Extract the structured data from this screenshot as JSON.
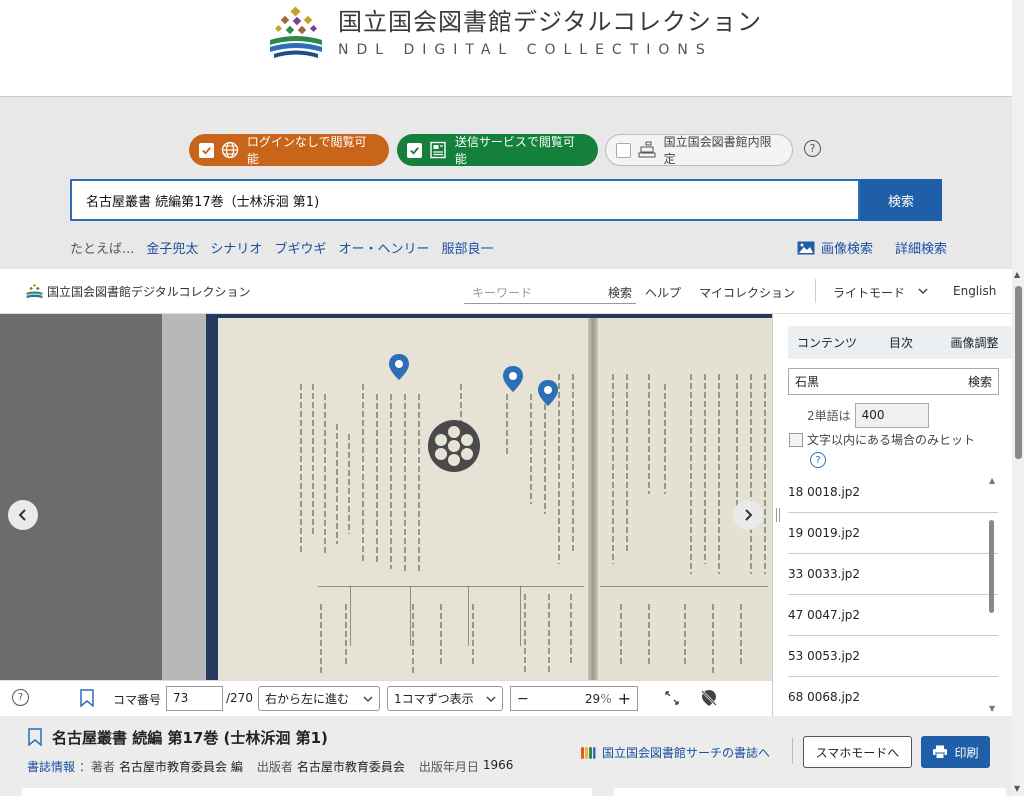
{
  "header": {
    "title_jp": "国立国会図書館デジタルコレクション",
    "title_en": "NDL DIGITAL COLLECTIONS",
    "logo_icon": "ndl-logo-icon"
  },
  "filters": {
    "login_free": "ログインなしで閲覧可能",
    "transmission": "送信サービスで閲覧可能",
    "inside_library": "国立国会図書館内限定",
    "help": "?"
  },
  "search": {
    "query": "名古屋叢書 続編第17巻（士林泝洄 第1)",
    "button": "検索",
    "examples_label": "たとえば...",
    "examples": [
      "金子兜太",
      "シナリオ",
      "ブギウギ",
      "オー・ヘンリー",
      "服部良一"
    ],
    "image_search": "画像検索",
    "advanced_search": "詳細検索"
  },
  "viewer_nav": {
    "logo_text": "国立国会図書館デジタルコレクション",
    "keyword_placeholder": "キーワード",
    "search": "検索",
    "help": "ヘルプ",
    "my_collection": "マイコレクション",
    "light_mode": "ライトモード",
    "english": "English"
  },
  "toolbar": {
    "help": "?",
    "frame_label": "コマ番号",
    "frame_value": "73",
    "frame_total": "/270",
    "direction": "右から左に進む",
    "display_mode": "1コマずつ表示",
    "zoom_minus": "−",
    "zoom_value": "29",
    "zoom_unit": "%",
    "zoom_plus": "+"
  },
  "side_panel": {
    "tabs": [
      "コンテンツ",
      "目次",
      "画像調整"
    ],
    "search_value": "石黒",
    "search_button": "検索",
    "words_label": "2単語は",
    "words_value": "400",
    "within_label": "文字以内にある場合のみヒット",
    "help": "?",
    "results": [
      "18 0018.jp2",
      "19 0019.jp2",
      "33 0033.jp2",
      "47 0047.jp2",
      "53 0053.jp2",
      "68 0068.jp2"
    ]
  },
  "bottom": {
    "title": "名古屋叢書 続編 第17巻 (士林泝洄 第1)",
    "biblio_link": "書誌情報",
    "author_key": "：著者",
    "author": "名古屋市教育委員会 編",
    "publisher_key": "出版者",
    "publisher": "名古屋市教育委員会",
    "date_key": "出版年月日",
    "date": "1966",
    "ndl_search": "国立国会図書館サーチの書誌へ",
    "smartphone_mode": "スマホモードへ",
    "print": "印刷"
  },
  "colors": {
    "login_pill": "#c8651b",
    "transmission_pill": "#14803c",
    "primary_blue": "#1f5fa8",
    "link_blue": "#1a4fa0"
  }
}
